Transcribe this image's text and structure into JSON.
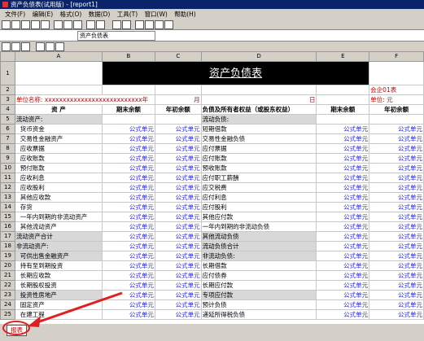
{
  "window_title": "资产负债表(试用版) - [report1]",
  "menu": [
    "文件(F)",
    "编辑(E)",
    "格式(O)",
    "数据(D)",
    "工具(T)",
    "窗口(W)",
    "帮助(H)"
  ],
  "cell_ref": "资产负债表",
  "columns": [
    "A",
    "B",
    "C",
    "D",
    "E",
    "F"
  ],
  "title": "资产负债表",
  "company": "单位名称: xxxxxxxxxxxxxxxxxxxxxxxxxxx年",
  "period": "月",
  "day": "日",
  "form_no": "会企01表",
  "unit": "单位: 元",
  "headers": [
    "资 产",
    "期末余额",
    "年初余额",
    "负债及所有者权益（或股东权益）",
    "期末余额",
    "年初余额"
  ],
  "formula": "公式单元",
  "rows": [
    {
      "n": "5",
      "a": "流动资产:",
      "d": "流动负债:"
    },
    {
      "n": "6",
      "a": "货币资金",
      "d": "短期借款",
      "f": true
    },
    {
      "n": "7",
      "a": "交易性金融资产",
      "d": "交易性金融负债",
      "f": true
    },
    {
      "n": "8",
      "a": "应收票据",
      "d": "应付票据",
      "f": true
    },
    {
      "n": "9",
      "a": "应收账款",
      "d": "应付账款",
      "f": true
    },
    {
      "n": "10",
      "a": "预付账款",
      "d": "预收账款",
      "f": true
    },
    {
      "n": "11",
      "a": "应收利息",
      "d": "应付职工薪酬",
      "f": true
    },
    {
      "n": "12",
      "a": "应收股利",
      "d": "应交税费",
      "f": true
    },
    {
      "n": "13",
      "a": "其他应收款",
      "d": "应付利息",
      "f": true
    },
    {
      "n": "14",
      "a": "存货",
      "d": "应付股利",
      "f": true
    },
    {
      "n": "15",
      "a": "一年内到期的非流动资产",
      "d": "其他应付款",
      "f": true
    },
    {
      "n": "16",
      "a": "其他流动资产",
      "d": "一年内到期的非流动负债",
      "f": true
    },
    {
      "n": "17",
      "a": "流动资产合计",
      "d": "其他流动负债",
      "f": true
    },
    {
      "n": "18",
      "a": "非流动资产:",
      "d": "流动负债合计",
      "f": true
    },
    {
      "n": "19",
      "a": "可供出售金融资产",
      "d": "非流动负债:",
      "f": true
    },
    {
      "n": "20",
      "a": "持有至到期投资",
      "d": "长期借款",
      "f": true
    },
    {
      "n": "21",
      "a": "长期应收款",
      "d": "应付债券",
      "f": true
    },
    {
      "n": "22",
      "a": "长期股权投资",
      "d": "长期应付款",
      "f": true
    },
    {
      "n": "23",
      "a": "投资性房地产",
      "d": "专项应付款",
      "f": true
    },
    {
      "n": "24",
      "a": "固定资产",
      "d": "预计负债",
      "f": true
    },
    {
      "n": "25",
      "a": "在建工程",
      "d": "递延所得税负债",
      "f": true
    }
  ],
  "sheet_tab": "报表"
}
